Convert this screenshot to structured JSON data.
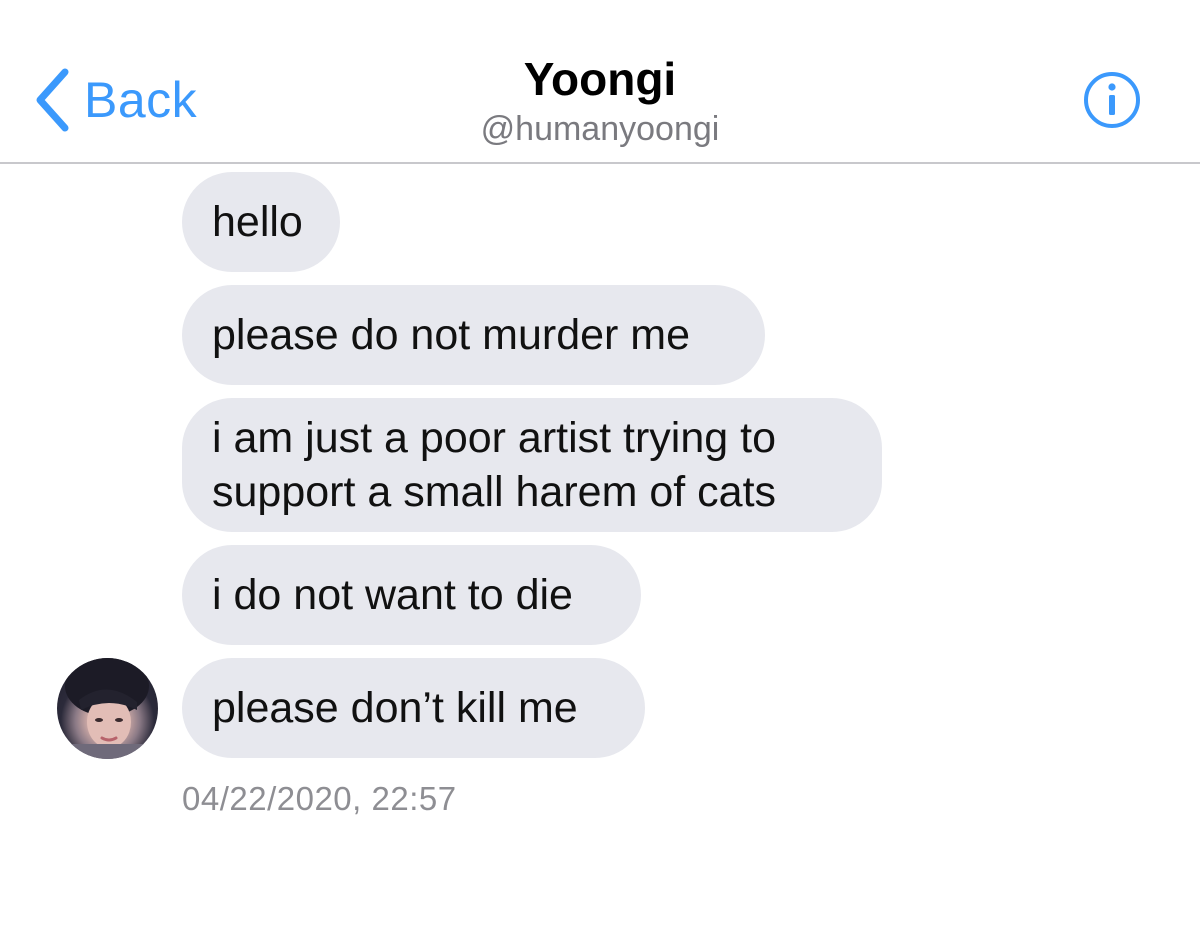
{
  "header": {
    "back_label": "Back",
    "title": "Yoongi",
    "handle": "@humanyoongi",
    "back_icon": "chevron-left-icon",
    "info_icon": "info-circle-icon",
    "accent_color": "#3b99fc"
  },
  "messages": [
    {
      "text": "hello"
    },
    {
      "text": "please do not murder me"
    },
    {
      "text": "i am just a poor artist trying to\nsupport a small harem of cats"
    },
    {
      "text": "i do not want to die"
    },
    {
      "text": "please don’t kill me"
    }
  ],
  "timestamp": "04/22/2020, 22:57",
  "colors": {
    "bubble": "#e7e8ee",
    "timestamp": "#8e8e93",
    "handle": "#7a7a7f",
    "divider": "#c8c8cc"
  }
}
